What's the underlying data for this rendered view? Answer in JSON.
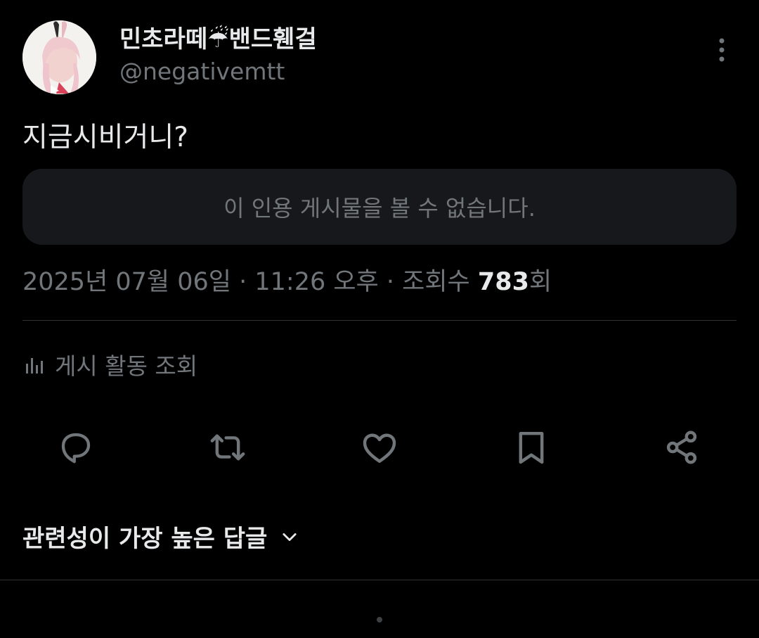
{
  "author": {
    "display_name": "민초라떼☔밴드휀걸",
    "handle": "@negativemtt"
  },
  "tweet": {
    "text": "지금시비거니?",
    "quote_unavailable": "이 인용 게시물을 볼 수 없습니다.",
    "meta_prefix": "2025년 07월 06일 · 11:26 오후 · 조회수 ",
    "views": "783",
    "views_suffix": "회"
  },
  "activity": {
    "label": "게시 활동 조회",
    "icon": "analytics-icon"
  },
  "actions": [
    {
      "name": "reply",
      "icon": "reply-icon"
    },
    {
      "name": "repost",
      "icon": "repost-icon"
    },
    {
      "name": "like",
      "icon": "heart-icon"
    },
    {
      "name": "bookmark",
      "icon": "bookmark-icon"
    },
    {
      "name": "share",
      "icon": "share-icon"
    }
  ],
  "replies": {
    "sort_label": "관련성이 가장 높은 답글"
  },
  "colors": {
    "background": "#000000",
    "text_primary": "#e7e9ea",
    "text_secondary": "#71767b",
    "quote_background": "#16181c",
    "divider": "#2f3336"
  }
}
